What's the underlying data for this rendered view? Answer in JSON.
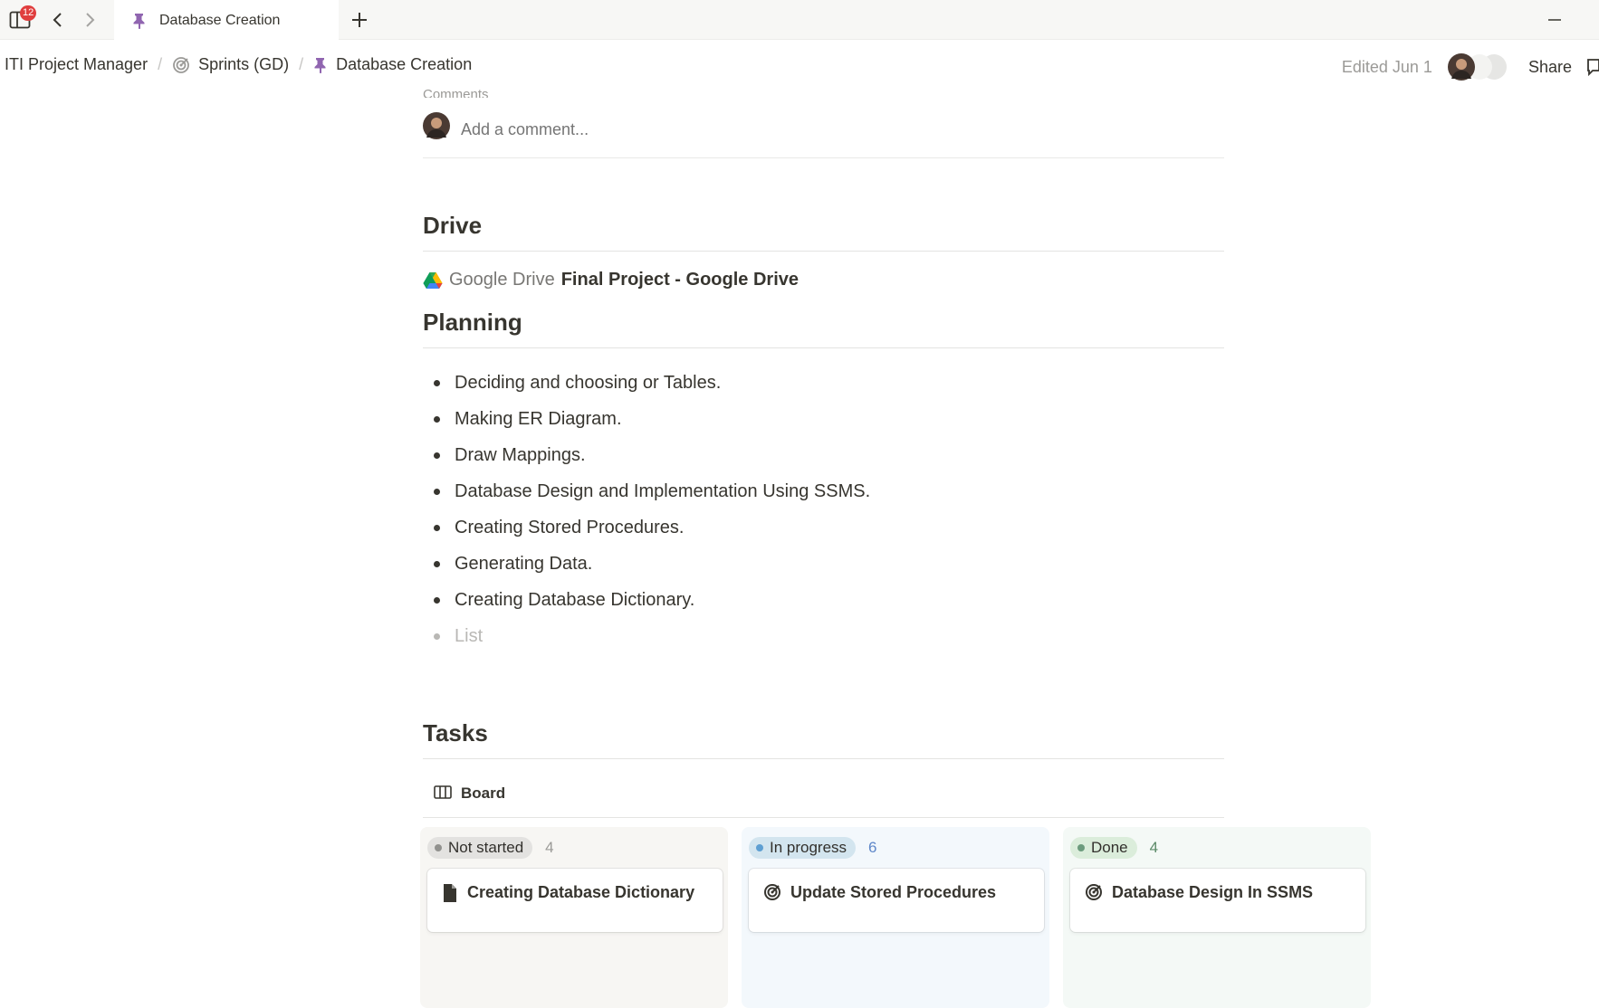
{
  "tabstrip": {
    "badge_count": "12",
    "active_tab": {
      "title": "Database Creation",
      "icon": "pin-icon"
    }
  },
  "breadcrumb": [
    {
      "label": "ITI Project Manager",
      "icon": ""
    },
    {
      "label": "Sprints (GD)",
      "icon": "target-icon"
    },
    {
      "label": "Database Creation",
      "icon": "pin-icon"
    }
  ],
  "header": {
    "edited": "Edited Jun 1",
    "share_label": "Share"
  },
  "comments": {
    "label": "Comments",
    "placeholder": "Add a comment..."
  },
  "drive": {
    "heading": "Drive",
    "service": "Google Drive",
    "link_title": "Final Project - Google Drive"
  },
  "planning": {
    "heading": "Planning",
    "items": [
      "Deciding and choosing or Tables.",
      "Making ER Diagram.",
      "Draw Mappings.",
      "Database Design and Implementation Using SSMS.",
      "Creating Stored Procedures.",
      "Generating Data.",
      "Creating Database Dictionary."
    ],
    "placeholder": "List"
  },
  "tasks": {
    "heading": "Tasks",
    "view_label": "Board",
    "columns": [
      {
        "status": "Not started",
        "count": "4",
        "bg": "#f7f6f3",
        "pill_bg": "#e3e2e0",
        "dot": "#91918e",
        "count_color": "#9b9a97",
        "first_card": {
          "title": "Creating Database Dictionary",
          "icon": "page-icon"
        }
      },
      {
        "status": "In progress",
        "count": "6",
        "bg": "#f3f8fc",
        "pill_bg": "#d3e5ef",
        "dot": "#5e9fd2",
        "count_color": "#5e87c9",
        "first_card": {
          "title": "Update Stored Procedures",
          "icon": "target-icon"
        }
      },
      {
        "status": "Done",
        "count": "4",
        "bg": "#f4f9f6",
        "pill_bg": "#dbeddb",
        "dot": "#6c9b7d",
        "count_color": "#5b8a68",
        "first_card": {
          "title": "Database Design In SSMS",
          "icon": "target-icon"
        }
      }
    ]
  }
}
